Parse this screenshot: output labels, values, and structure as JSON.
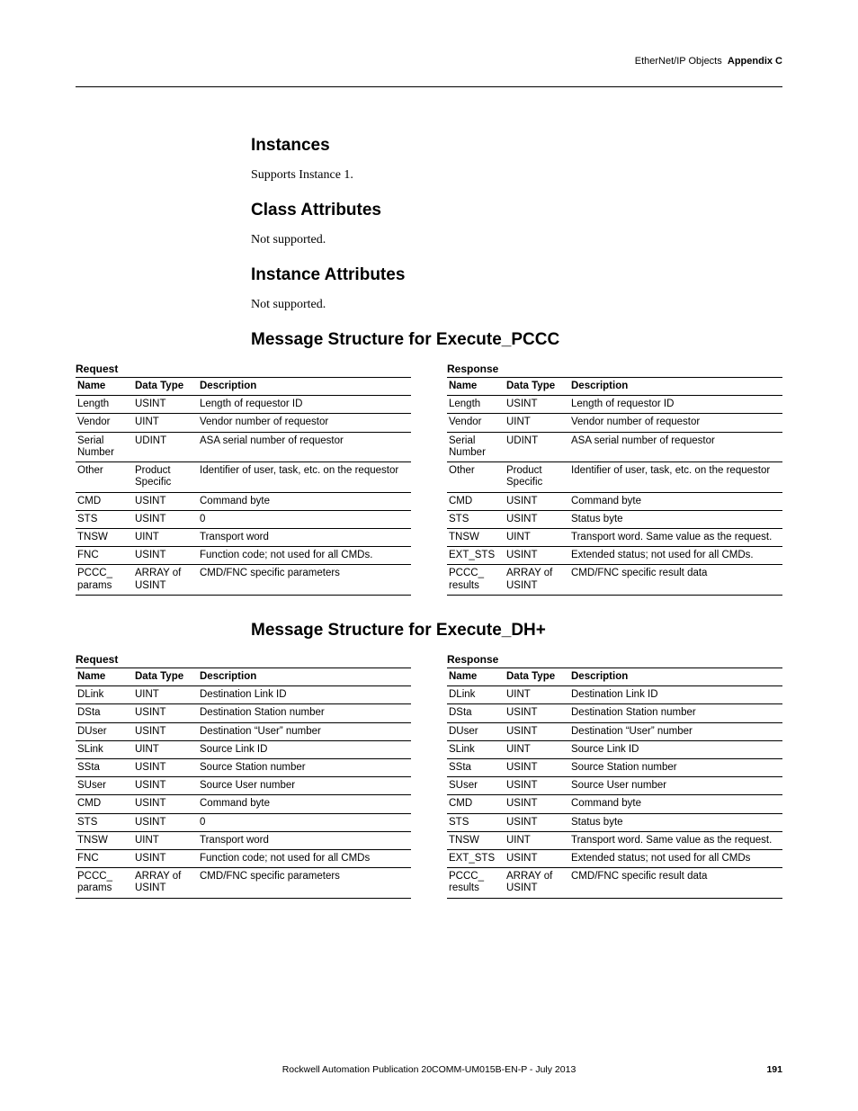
{
  "header": {
    "left": "EtherNet/IP Objects",
    "right": "Appendix C"
  },
  "sections": [
    {
      "heading": "Instances",
      "body": "Supports Instance 1."
    },
    {
      "heading": "Class Attributes",
      "body": "Not supported."
    },
    {
      "heading": "Instance Attributes",
      "body": "Not supported."
    }
  ],
  "msg1_heading": "Message Structure for Execute_PCCC",
  "msg2_heading": "Message Structure for Execute_DH+",
  "labels": {
    "request": "Request",
    "response": "Response",
    "name": "Name",
    "datatype": "Data Type",
    "description": "Description"
  },
  "pccc_request": [
    [
      "Length",
      "USINT",
      "Length of requestor ID"
    ],
    [
      "Vendor",
      "UINT",
      "Vendor number of requestor"
    ],
    [
      "Serial Number",
      "UDINT",
      "ASA serial number of requestor"
    ],
    [
      "Other",
      "Product Specific",
      "Identifier of user, task, etc. on the requestor"
    ],
    [
      "CMD",
      "USINT",
      "Command byte"
    ],
    [
      "STS",
      "USINT",
      "0"
    ],
    [
      "TNSW",
      "UINT",
      "Transport word"
    ],
    [
      "FNC",
      "USINT",
      "Function code; not used for all CMDs."
    ],
    [
      "PCCC_ params",
      "ARRAY of USINT",
      "CMD/FNC specific parameters"
    ]
  ],
  "pccc_response": [
    [
      "Length",
      "USINT",
      "Length of requestor ID"
    ],
    [
      "Vendor",
      "UINT",
      "Vendor number of requestor"
    ],
    [
      "Serial Number",
      "UDINT",
      "ASA serial number of requestor"
    ],
    [
      "Other",
      "Product Specific",
      "Identifier of user, task, etc. on the requestor"
    ],
    [
      "CMD",
      "USINT",
      "Command byte"
    ],
    [
      "STS",
      "USINT",
      "Status byte"
    ],
    [
      "TNSW",
      "UINT",
      "Transport word. Same value as the request."
    ],
    [
      "EXT_STS",
      "USINT",
      "Extended status; not used for all CMDs."
    ],
    [
      "PCCC_ results",
      "ARRAY of USINT",
      "CMD/FNC specific result data"
    ]
  ],
  "dh_request": [
    [
      "DLink",
      "UINT",
      "Destination Link ID"
    ],
    [
      "DSta",
      "USINT",
      "Destination Station number"
    ],
    [
      "DUser",
      "USINT",
      "Destination “User” number"
    ],
    [
      "SLink",
      "UINT",
      "Source Link ID"
    ],
    [
      "SSta",
      "USINT",
      "Source Station number"
    ],
    [
      "SUser",
      "USINT",
      "Source User number"
    ],
    [
      "CMD",
      "USINT",
      "Command byte"
    ],
    [
      "STS",
      "USINT",
      "0"
    ],
    [
      "TNSW",
      "UINT",
      "Transport word"
    ],
    [
      "FNC",
      "USINT",
      "Function code; not used for all CMDs"
    ],
    [
      "PCCC_ params",
      "ARRAY of USINT",
      "CMD/FNC specific parameters"
    ]
  ],
  "dh_response": [
    [
      "DLink",
      "UINT",
      "Destination Link ID"
    ],
    [
      "DSta",
      "USINT",
      "Destination Station number"
    ],
    [
      "DUser",
      "USINT",
      "Destination “User” number"
    ],
    [
      "SLink",
      "UINT",
      "Source Link ID"
    ],
    [
      "SSta",
      "USINT",
      "Source Station number"
    ],
    [
      "SUser",
      "USINT",
      "Source User number"
    ],
    [
      "CMD",
      "USINT",
      "Command byte"
    ],
    [
      "STS",
      "USINT",
      "Status byte"
    ],
    [
      "TNSW",
      "UINT",
      "Transport word. Same value as the request."
    ],
    [
      "EXT_STS",
      "USINT",
      "Extended status; not used for all CMDs"
    ],
    [
      "PCCC_ results",
      "ARRAY of USINT",
      "CMD/FNC specific result data"
    ]
  ],
  "footer": {
    "pub": "Rockwell Automation Publication  20COMM-UM015B-EN-P - July 2013",
    "page": "191"
  }
}
